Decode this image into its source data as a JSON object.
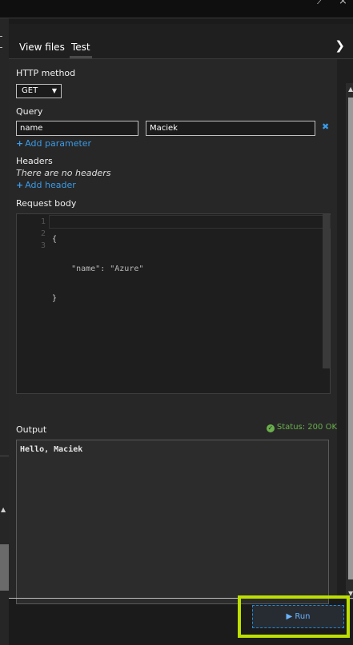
{
  "tabs": [
    {
      "label": "View files"
    },
    {
      "label": "Test"
    }
  ],
  "test": {
    "http_method_label": "HTTP method",
    "http_method_value": "GET",
    "query_label": "Query",
    "query_param": {
      "name": "name",
      "value": "Maciek"
    },
    "add_parameter": "Add parameter",
    "headers_label": "Headers",
    "headers_empty": "There are no headers",
    "add_header": "Add header",
    "request_body_label": "Request body",
    "request_body": {
      "line_numbers": [
        "1",
        "2",
        "3"
      ],
      "lines": [
        "{",
        "    \"name\": \"Azure\"",
        "}"
      ]
    },
    "output_label": "Output",
    "status": "Status: 200 OK",
    "output_text": "Hello, Maciek",
    "run_label": "Run"
  },
  "colors": {
    "accent": "#3a9be8",
    "status_ok": "#6ab04c",
    "highlight": "#bde000"
  }
}
